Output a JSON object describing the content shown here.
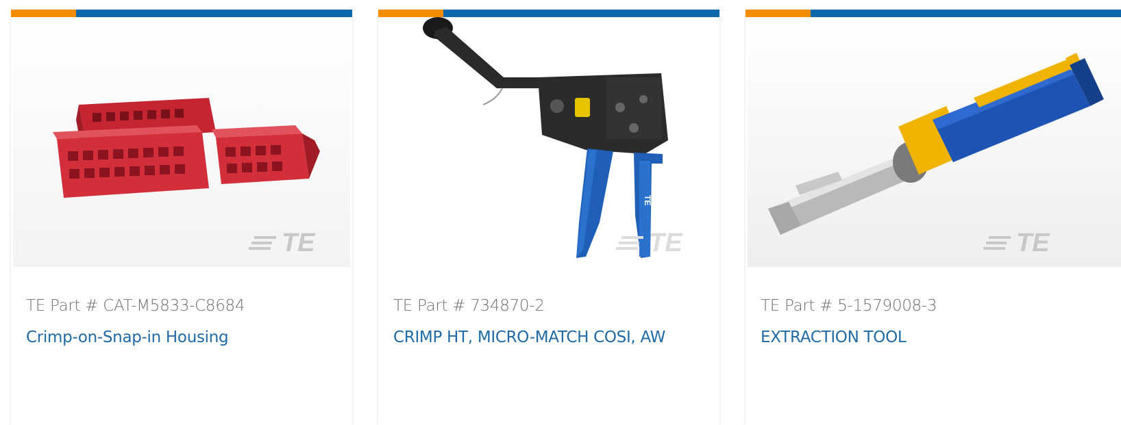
{
  "colors": {
    "accent_orange": "#f28d00",
    "accent_blue": "#0e68a9",
    "title_link": "#1f6aa5",
    "part_text": "#6f6f6f"
  },
  "cards": [
    {
      "part_number": "TE Part # CAT-M5833-C8684",
      "title": "Crimp-on-Snap-in Housing",
      "image_icon": "red-housing-connector-image",
      "watermark": "TE"
    },
    {
      "part_number": "TE Part # 734870-2",
      "title": "CRIMP HT, MICRO-MATCH COSI, AW",
      "image_icon": "crimp-hand-tool-image",
      "watermark": "TE"
    },
    {
      "part_number": "TE Part # 5-1579008-3",
      "title": "EXTRACTION TOOL",
      "image_icon": "extraction-tool-image",
      "watermark": "TE"
    }
  ]
}
